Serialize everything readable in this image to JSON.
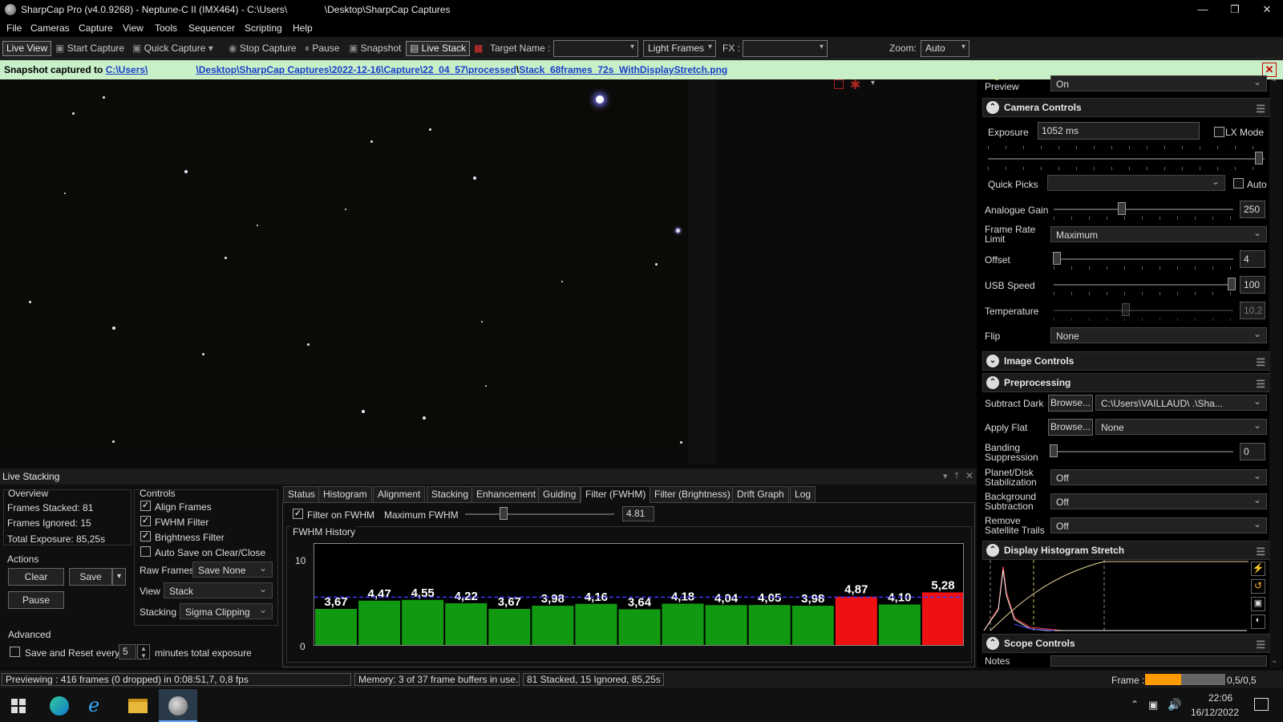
{
  "window": {
    "title": "SharpCap Pro (v4.0.9268) - Neptune-C II (IMX464) - C:\\Users\\              \\Desktop\\SharpCap Captures",
    "minimize": "—",
    "maximize": "❐",
    "close": "✕"
  },
  "menu": [
    "File",
    "Cameras",
    "Capture",
    "View",
    "Tools",
    "Sequencer",
    "Scripting",
    "Help"
  ],
  "toolbar": {
    "live_view": "Live View",
    "start_capture": "Start Capture",
    "quick_capture": "Quick Capture",
    "stop_capture": "Stop Capture",
    "pause": "Pause",
    "snapshot": "Snapshot",
    "live_stack": "Live Stack",
    "target_label": "Target Name :",
    "target_value": "",
    "frame_type": "Light Frames",
    "fx_label": "FX :",
    "fx_value": "",
    "zoom_label": "Zoom:",
    "zoom_value": "Auto"
  },
  "notice": {
    "prefix": "Snapshot captured to ",
    "path1": "C:\\Users\\",
    "path2": "\\Desktop\\SharpCap Captures\\2022-12-16\\Capture\\22_04_57\\processed",
    "path3": "\\",
    "file": "Stack_68frames_72s_WithDisplayStretch.png"
  },
  "side": {
    "preview_label": "Preview",
    "preview_value": "On",
    "camera_controls": "Camera Controls",
    "exposure_label": "Exposure",
    "exposure_value": "1052 ms",
    "lx_mode": "LX Mode",
    "exposure_slider": 0.98,
    "quick_picks": "Quick Picks",
    "auto": "Auto",
    "gain_label": "Analogue Gain",
    "gain_value": "250",
    "gain_slider": 0.38,
    "fps_label": "Frame Rate Limit",
    "fps_value": "Maximum",
    "offset_label": "Offset",
    "offset_value": "4",
    "offset_slider": 0.02,
    "usb_label": "USB Speed",
    "usb_value": "100",
    "usb_slider": 0.99,
    "temp_label": "Temperature",
    "temp_value": "10,2",
    "temp_slider": 0.4,
    "flip_label": "Flip",
    "flip_value": "None",
    "image_controls": "Image Controls",
    "preprocessing": "Preprocessing",
    "dark_label": "Subtract Dark",
    "browse": "Browse...",
    "dark_value": "C:\\Users\\VAILLAUD\\        .\\Sha...",
    "flat_label": "Apply Flat",
    "flat_value": "None",
    "banding_label": "Banding Suppression",
    "banding_value": "0",
    "planet_label": "Planet/Disk Stabilization",
    "planet_value": "Off",
    "bg_label": "Background Subtraction",
    "bg_value": "Off",
    "sat_label": "Remove Satellite Trails",
    "sat_value": "Off",
    "histogram": "Display Histogram Stretch",
    "scope": "Scope Controls",
    "notes": "Notes"
  },
  "live_stacking": {
    "title": "Live Stacking",
    "overview": "Overview",
    "frames_stacked": "Frames Stacked: 81",
    "frames_ignored": "Frames Ignored: 15",
    "total_exposure": "Total Exposure:  85,25s",
    "actions": "Actions",
    "clear": "Clear",
    "save": "Save",
    "pause": "Pause",
    "controls": "Controls",
    "align": "Align Frames",
    "fwhm_filter": "FWHM Filter",
    "brightness_filter": "Brightness Filter",
    "auto_save": "Auto Save on Clear/Close",
    "raw_frames_label": "Raw Frames",
    "raw_frames_value": "Save None",
    "view_label": "View",
    "view_value": "Stack",
    "stacking_label": "Stacking",
    "stacking_value": "Sigma Clipping",
    "advanced": "Advanced",
    "save_reset": "Save and Reset every",
    "minutes_value": "5",
    "minutes_label": "minutes total exposure",
    "tabs": [
      "Status",
      "Histogram",
      "Alignment",
      "Stacking",
      "Enhancement",
      "Guiding",
      "Filter (FWHM)",
      "Filter (Brightness)",
      "Drift Graph",
      "Log"
    ],
    "filter_on_fwhm": "Filter on FWHM",
    "max_fwhm_label": "Maximum FWHM",
    "max_fwhm_value": "4.81",
    "max_fwhm_slider": 0.26,
    "fwhm_history": "FWHM History"
  },
  "chart_data": {
    "type": "bar",
    "title": "FWHM History",
    "ylim": [
      0,
      10
    ],
    "y_ticks": [
      "10",
      "0"
    ],
    "threshold": 4.81,
    "labels": [
      "3,67",
      "4,47",
      "4,55",
      "4,22",
      "3,67",
      "3,98",
      "4,16",
      "3,64",
      "4,18",
      "4,04",
      "4,05",
      "3,98",
      "4,87",
      "4,10",
      "5,28"
    ],
    "values": [
      3.67,
      4.47,
      4.55,
      4.22,
      3.67,
      3.98,
      4.16,
      3.64,
      4.18,
      4.04,
      4.05,
      3.98,
      4.87,
      4.1,
      5.28
    ],
    "colors": {
      "pass": "#119911",
      "fail": "#ee1111",
      "threshold": "#3a3aff"
    }
  },
  "status": {
    "preview": "Previewing : 416 frames (0 dropped) in 0:08:51,7, 0,8 fps",
    "memory": "Memory: 3 of 37 frame buffers in use.",
    "stack": "81 Stacked, 15 Ignored, 85,25s",
    "frame_label": "Frame :",
    "frame_value": "0,5/0,5",
    "frame_progress": 0.45
  },
  "taskbar": {
    "time": "22:06",
    "date": "16/12/2022"
  }
}
